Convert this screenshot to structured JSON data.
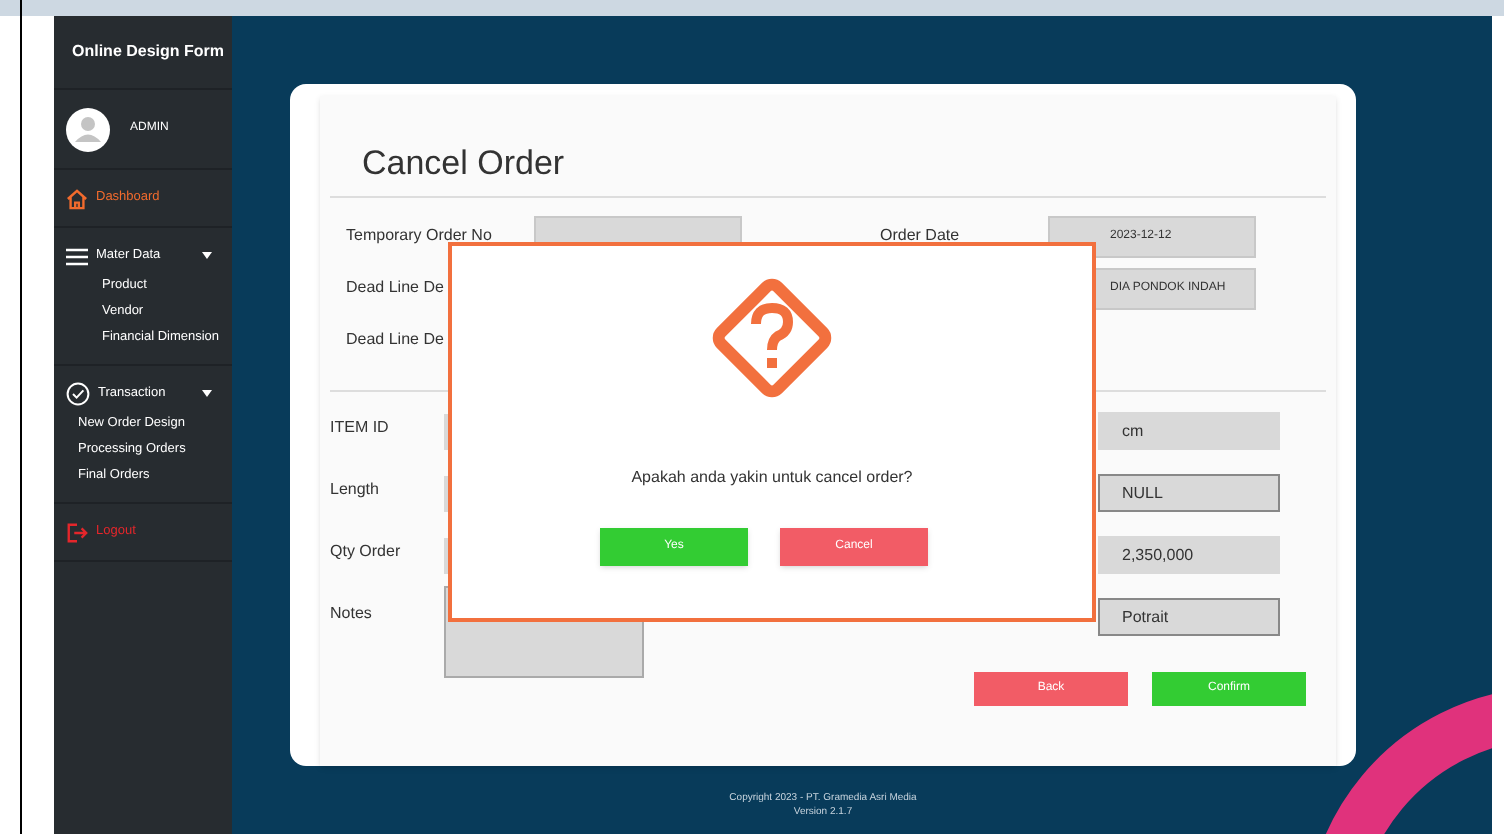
{
  "sidebar": {
    "title": "Online Design Form",
    "user": {
      "name": "ADMIN"
    },
    "items": [
      {
        "label": "Dashboard",
        "kind": "home",
        "selected": true
      },
      {
        "label": "Mater Data",
        "kind": "menu",
        "expanded": true,
        "children": [
          {
            "label": "Product"
          },
          {
            "label": "Vendor"
          },
          {
            "label": "Financial Dimension"
          }
        ]
      },
      {
        "label": "Transaction",
        "kind": "check",
        "expanded": true,
        "children": [
          {
            "label": "New Order Design"
          },
          {
            "label": "Processing Orders"
          },
          {
            "label": "Final Orders"
          }
        ]
      },
      {
        "label": "Logout",
        "kind": "logout"
      }
    ]
  },
  "form": {
    "title": "Cancel Order",
    "header": [
      {
        "label": "Temporary Order No",
        "field": true,
        "right_label": "Order Date",
        "right_value": "2023-12-12"
      },
      {
        "label": "Dead Line De",
        "right_value": "DIA PONDOK INDAH"
      },
      {
        "label": "Dead Line De"
      }
    ],
    "items": [
      {
        "label": "ITEM ID",
        "value": "cm",
        "kind": "readonly"
      },
      {
        "label": "Length",
        "value": "NULL",
        "kind": "input"
      },
      {
        "label": "Qty Order",
        "value": "2,350,000",
        "kind": "readonly"
      },
      {
        "label": "Notes",
        "value": "Potrait",
        "kind": "input",
        "textarea": true
      }
    ],
    "buttons": [
      {
        "label": "Back",
        "kind": "back"
      },
      {
        "label": "Confirm",
        "kind": "confirm"
      }
    ]
  },
  "dialog": {
    "message": "Apakah anda yakin untuk cancel order?",
    "buttons": [
      {
        "label": "Yes",
        "kind": "confirm"
      },
      {
        "label": "Cancel",
        "kind": "cancel"
      }
    ]
  },
  "footer": {
    "copyright": "Copyright 2023 - PT. Gramedia Asri Media",
    "version": "Version 2.1.7"
  }
}
